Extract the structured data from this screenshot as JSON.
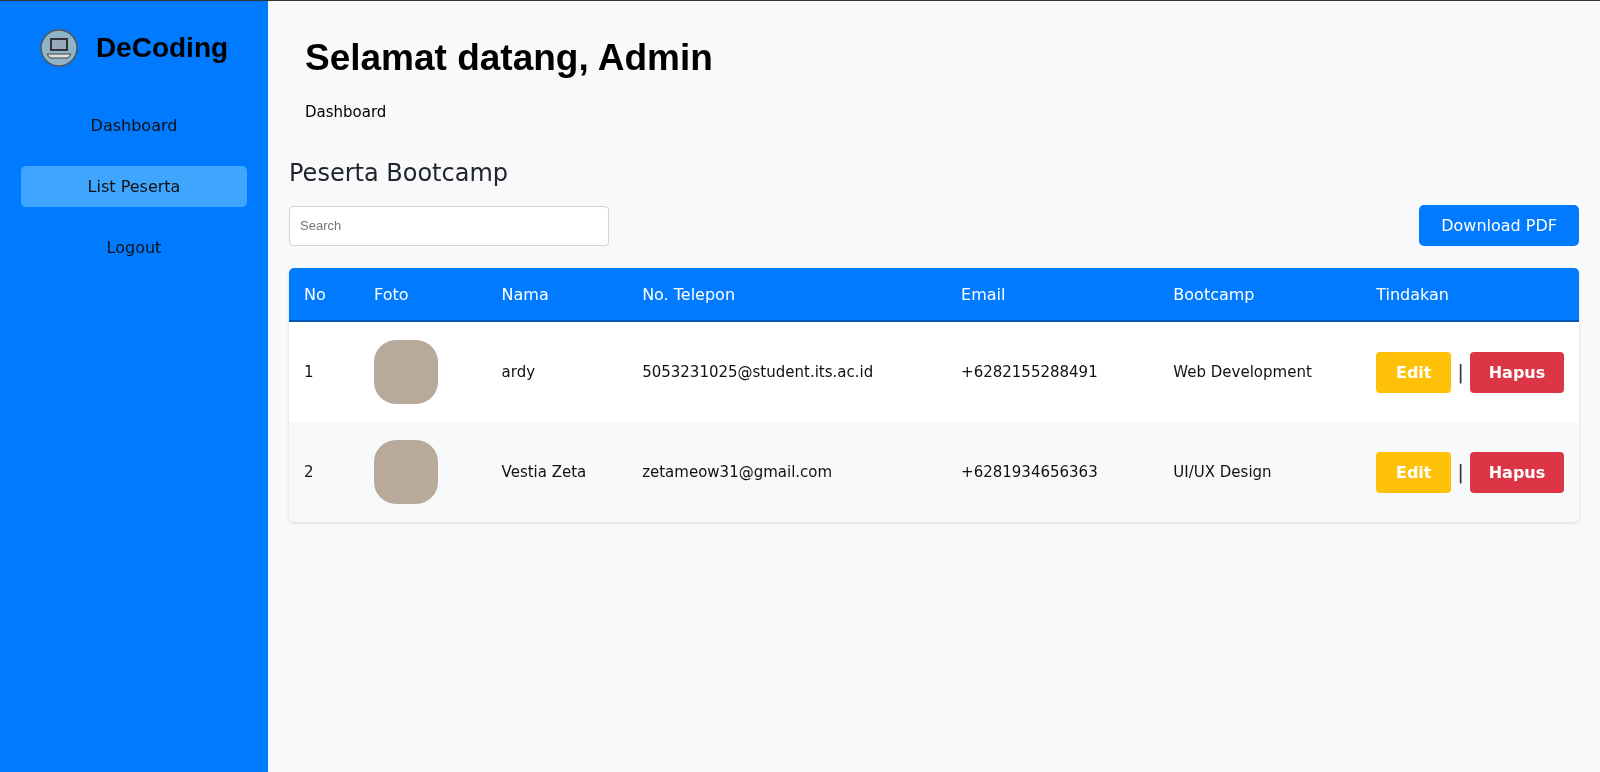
{
  "sidebar": {
    "brand": "DeCoding",
    "items": [
      {
        "label": "Dashboard",
        "selected": false
      },
      {
        "label": "List Peserta",
        "selected": true
      },
      {
        "label": "Logout",
        "selected": false
      }
    ]
  },
  "header": {
    "title": "Selamat datang, Admin",
    "breadcrumb": "Dashboard"
  },
  "section_title": "Peserta Bootcamp",
  "search": {
    "placeholder": "Search"
  },
  "download_button": "Download PDF",
  "table": {
    "columns": [
      "No",
      "Foto",
      "Nama",
      "No. Telepon",
      "Email",
      "Bootcamp",
      "Tindakan"
    ],
    "rows": [
      {
        "no": "1",
        "name": "ardy",
        "phone": "5053231025@student.its.ac.id",
        "email": "+6282155288491",
        "bootcamp": "Web Development",
        "edit": "Edit",
        "separator": "|",
        "delete": "Hapus"
      },
      {
        "no": "2",
        "name": "Vestia Zeta",
        "phone": "zetameow31@gmail.com",
        "email": "+6281934656363",
        "bootcamp": "UI/UX Design",
        "edit": "Edit",
        "separator": "|",
        "delete": "Hapus"
      }
    ]
  }
}
